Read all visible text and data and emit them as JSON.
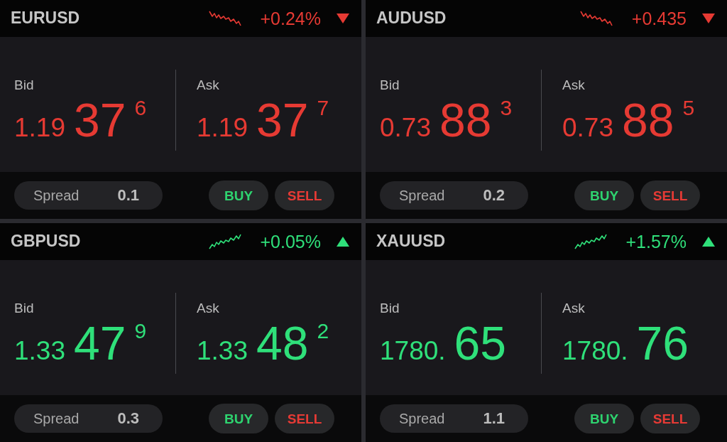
{
  "tiles": [
    {
      "symbol": "EURUSD",
      "kind": "falling",
      "change": "+0.24%",
      "bid": {
        "label": "Bid",
        "prefix": "1.19",
        "figures": "37",
        "pip": "6"
      },
      "ask": {
        "label": "Ask",
        "prefix": "1.19",
        "figures": "37",
        "pip": "7"
      },
      "spread": {
        "label": "Spread",
        "value": "0.1"
      },
      "buttons": [
        {
          "label": "BUY",
          "kind": "buy"
        },
        {
          "label": "SELL",
          "kind": "sell"
        }
      ]
    },
    {
      "symbol": "AUDUSD",
      "kind": "falling",
      "change": "+0.435",
      "bid": {
        "label": "Bid",
        "prefix": "0.73",
        "figures": "88",
        "pip": "3"
      },
      "ask": {
        "label": "Ask",
        "prefix": "0.73",
        "figures": "88",
        "pip": "5"
      },
      "spread": {
        "label": "Spread",
        "value": "0.2"
      },
      "buttons": [
        {
          "label": "BUY",
          "kind": "buy"
        },
        {
          "label": "SELL",
          "kind": "sell"
        }
      ]
    },
    {
      "symbol": "GBPUSD",
      "kind": "rising",
      "change": "+0.05%",
      "bid": {
        "label": "Bid",
        "prefix": "1.33",
        "figures": "47",
        "pip": "9"
      },
      "ask": {
        "label": "Ask",
        "prefix": "1.33",
        "figures": "48",
        "pip": "2"
      },
      "spread": {
        "label": "Spread",
        "value": "0.3"
      },
      "buttons": [
        {
          "label": "BUY",
          "kind": "buy"
        },
        {
          "label": "SELL",
          "kind": "sell"
        }
      ]
    },
    {
      "symbol": "XAUUSD",
      "kind": "rising",
      "change": "+1.57%",
      "bid": {
        "label": "Bid",
        "prefix": "1780.",
        "figures": "65"
      },
      "ask": {
        "label": "Ask",
        "prefix": "1780.",
        "figures": "76"
      },
      "spread": {
        "label": "Spread",
        "value": "1.1"
      },
      "buttons": [
        {
          "label": "BUY",
          "kind": "buy"
        },
        {
          "label": "SELL",
          "kind": "sell"
        }
      ]
    }
  ]
}
